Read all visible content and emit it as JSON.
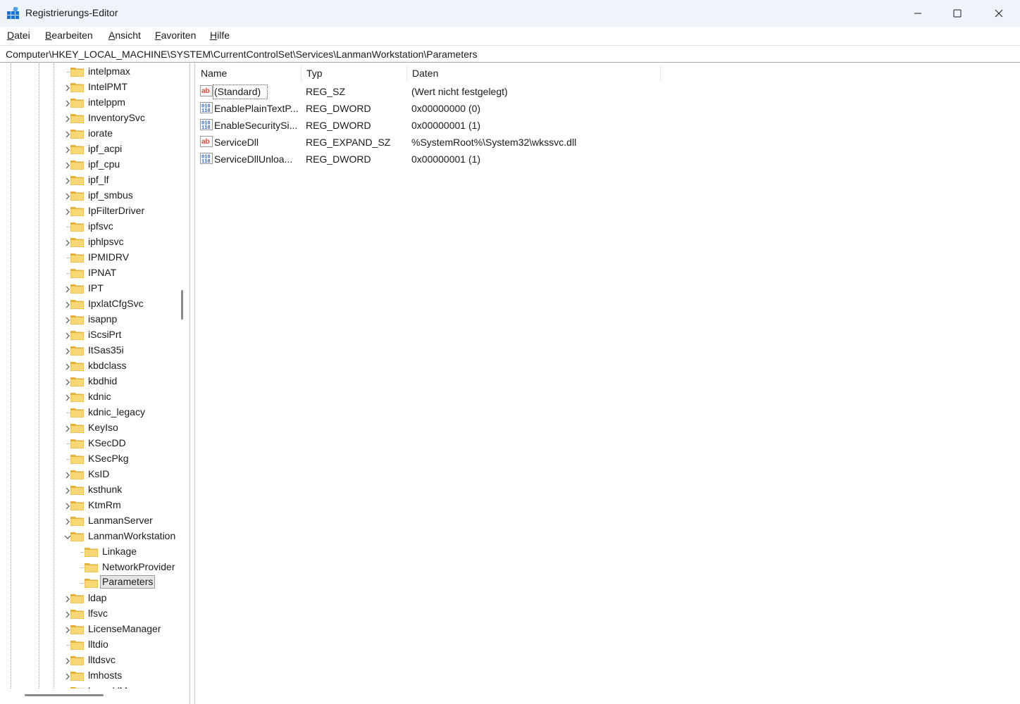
{
  "window": {
    "title": "Registrierungs-Editor",
    "minimize_symbol": "—",
    "maximize_symbol": "☐",
    "close_symbol": "✕"
  },
  "menu": [
    {
      "label": "Datei",
      "accel": "D",
      "rest": "atei"
    },
    {
      "label": "Bearbeiten",
      "accel": "B",
      "rest": "earbeiten"
    },
    {
      "label": "Ansicht",
      "accel": "A",
      "rest": "nsicht"
    },
    {
      "label": "Favoriten",
      "accel": "F",
      "rest": "avoriten"
    },
    {
      "label": "Hilfe",
      "accel": "H",
      "rest": "ilfe"
    }
  ],
  "address": {
    "path": "Computer\\HKEY_LOCAL_MACHINE\\SYSTEM\\CurrentControlSet\\Services\\LanmanWorkstation\\Parameters"
  },
  "tree": {
    "items": [
      {
        "label": "intelpmax",
        "expander": false,
        "level": 0
      },
      {
        "label": "IntelPMT",
        "expander": true,
        "level": 0
      },
      {
        "label": "intelppm",
        "expander": true,
        "level": 0
      },
      {
        "label": "InventorySvc",
        "expander": true,
        "level": 0
      },
      {
        "label": "iorate",
        "expander": true,
        "level": 0
      },
      {
        "label": "ipf_acpi",
        "expander": true,
        "level": 0
      },
      {
        "label": "ipf_cpu",
        "expander": true,
        "level": 0
      },
      {
        "label": "ipf_lf",
        "expander": true,
        "level": 0
      },
      {
        "label": "ipf_smbus",
        "expander": true,
        "level": 0
      },
      {
        "label": "IpFilterDriver",
        "expander": true,
        "level": 0
      },
      {
        "label": "ipfsvc",
        "expander": false,
        "level": 0
      },
      {
        "label": "iphlpsvc",
        "expander": true,
        "level": 0
      },
      {
        "label": "IPMIDRV",
        "expander": false,
        "level": 0
      },
      {
        "label": "IPNAT",
        "expander": false,
        "level": 0
      },
      {
        "label": "IPT",
        "expander": true,
        "level": 0
      },
      {
        "label": "IpxlatCfgSvc",
        "expander": true,
        "level": 0
      },
      {
        "label": "isapnp",
        "expander": true,
        "level": 0
      },
      {
        "label": "iScsiPrt",
        "expander": true,
        "level": 0
      },
      {
        "label": "ItSas35i",
        "expander": true,
        "level": 0
      },
      {
        "label": "kbdclass",
        "expander": true,
        "level": 0
      },
      {
        "label": "kbdhid",
        "expander": true,
        "level": 0
      },
      {
        "label": "kdnic",
        "expander": true,
        "level": 0
      },
      {
        "label": "kdnic_legacy",
        "expander": false,
        "level": 0
      },
      {
        "label": "KeyIso",
        "expander": true,
        "level": 0
      },
      {
        "label": "KSecDD",
        "expander": false,
        "level": 0
      },
      {
        "label": "KSecPkg",
        "expander": false,
        "level": 0
      },
      {
        "label": "KsID",
        "expander": true,
        "level": 0
      },
      {
        "label": "ksthunk",
        "expander": true,
        "level": 0
      },
      {
        "label": "KtmRm",
        "expander": true,
        "level": 0
      },
      {
        "label": "LanmanServer",
        "expander": true,
        "level": 0
      },
      {
        "label": "LanmanWorkstation",
        "expander": "open",
        "level": 0
      },
      {
        "label": "Linkage",
        "expander": false,
        "level": 1
      },
      {
        "label": "NetworkProvider",
        "expander": false,
        "level": 1
      },
      {
        "label": "Parameters",
        "expander": false,
        "level": 1,
        "selected": true
      },
      {
        "label": "ldap",
        "expander": true,
        "level": 0
      },
      {
        "label": "lfsvc",
        "expander": true,
        "level": 0
      },
      {
        "label": "LicenseManager",
        "expander": true,
        "level": 0
      },
      {
        "label": "lltdio",
        "expander": false,
        "level": 0
      },
      {
        "label": "lltdsvc",
        "expander": true,
        "level": 0
      },
      {
        "label": "lmhosts",
        "expander": true,
        "level": 0
      },
      {
        "label": "LmanVM",
        "expander": true,
        "level": 0
      }
    ]
  },
  "list": {
    "columns": [
      "Name",
      "Typ",
      "Daten"
    ],
    "rows": [
      {
        "icon": "string-value-icon",
        "name": "(Standard)",
        "type": "REG_SZ",
        "data": "(Wert nicht festgelegt)"
      },
      {
        "icon": "binary-value-icon",
        "name": "EnablePlainTextP...",
        "type": "REG_DWORD",
        "data": "0x00000000 (0)"
      },
      {
        "icon": "binary-value-icon",
        "name": "EnableSecuritySi...",
        "type": "REG_DWORD",
        "data": "0x00000001 (1)"
      },
      {
        "icon": "string-value-icon",
        "name": "ServiceDll",
        "type": "REG_EXPAND_SZ",
        "data": "%SystemRoot%\\System32\\wkssvc.dll"
      },
      {
        "icon": "binary-value-icon",
        "name": "ServiceDllUnloa...",
        "type": "REG_DWORD",
        "data": "0x00000001 (1)"
      }
    ]
  },
  "colors": {
    "folder": "#f8d775",
    "folder_dark": "#e2b23c",
    "titlebar": "#eef4f9",
    "string_icon": "#d9483b",
    "binary_icon": "#2c63c7"
  }
}
